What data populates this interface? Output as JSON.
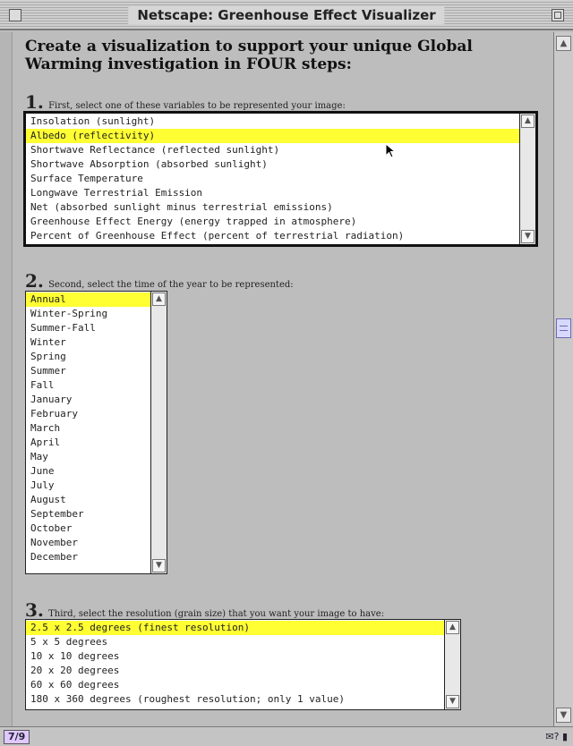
{
  "window": {
    "title": "Netscape: Greenhouse Effect Visualizer"
  },
  "headline": "Create a visualization to support your unique Global Warming investigation in FOUR steps:",
  "step1": {
    "number": "1.",
    "label": "First, select one of these variables to be represented your image:",
    "options": [
      "Insolation (sunlight)",
      "Albedo (reflectivity)",
      "Shortwave Reflectance (reflected sunlight)",
      "Shortwave Absorption (absorbed sunlight)",
      "Surface Temperature",
      "Longwave Terrestrial Emission",
      "Net (absorbed sunlight minus terrestrial emissions)",
      "Greenhouse Effect Energy (energy trapped in atmosphere)",
      "Percent of Greenhouse Effect (percent of terrestrial radiation)"
    ],
    "selected": "Albedo (reflectivity)"
  },
  "step2": {
    "number": "2.",
    "label": "Second, select the time of the year to be represented:",
    "options": [
      "Annual",
      "Winter-Spring",
      "Summer-Fall",
      "Winter",
      "Spring",
      "Summer",
      "Fall",
      "January",
      "February",
      "March",
      "April",
      "May",
      "June",
      "July",
      "August",
      "September",
      "October",
      "November",
      "December"
    ],
    "selected": "Annual"
  },
  "step3": {
    "number": "3.",
    "label": "Third, select the resolution (grain size) that you want your image to have:",
    "options": [
      "2.5 x 2.5 degrees (finest resolution)",
      "5 x 5 degrees",
      "10 x 10 degrees",
      "20 x 20 degrees",
      "60 x 60 degrees",
      "180 x 360 degrees (roughest resolution; only 1 value)"
    ],
    "selected": "2.5 x 2.5 degrees (finest resolution)"
  },
  "statusbar": {
    "zoom": "7/9",
    "icons": "✉? ▮"
  },
  "icons": {
    "scroll_up": "up-arrow-icon",
    "scroll_down": "down-arrow-icon",
    "close": "close-box-icon",
    "zoom": "zoom-box-icon"
  },
  "colors": {
    "selection": "#ffff33",
    "window_bg": "#bdbdbd"
  }
}
